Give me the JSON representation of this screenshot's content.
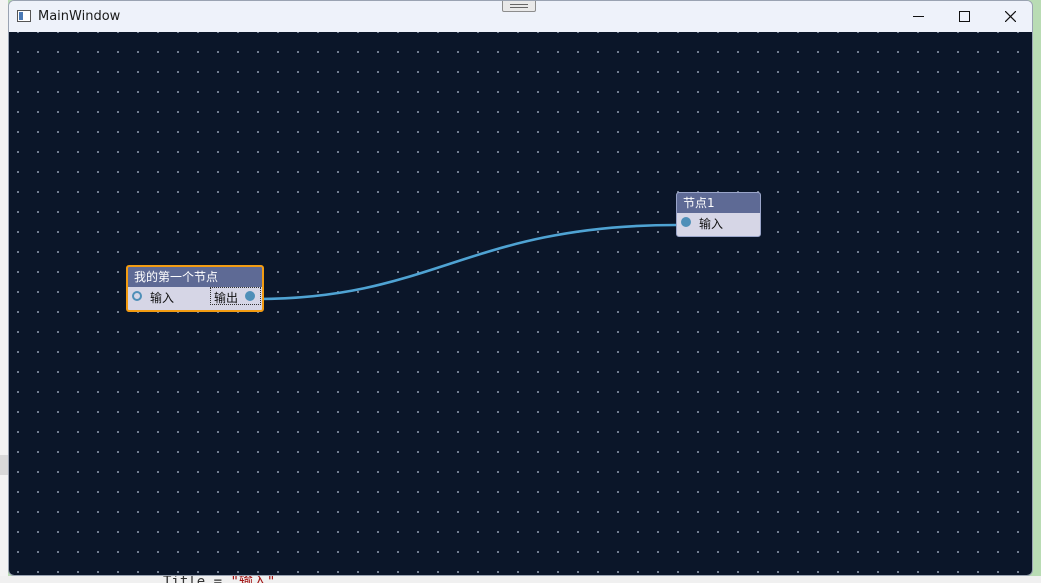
{
  "background_code": {
    "prefix": "Title = ",
    "string": "\"输入\""
  },
  "window": {
    "title": "MainWindow"
  },
  "colors": {
    "canvas": "#0b1629",
    "node_header": "#5e6a95",
    "node_body": "#d6d6e6",
    "selection": "#f39c12",
    "wire": "#4fa3d3"
  },
  "nodes": [
    {
      "title": "我的第一个节点",
      "selected": true,
      "input_label": "输入",
      "output_label": "输出"
    },
    {
      "title": "节点1",
      "selected": false,
      "input_label": "输入"
    }
  ]
}
